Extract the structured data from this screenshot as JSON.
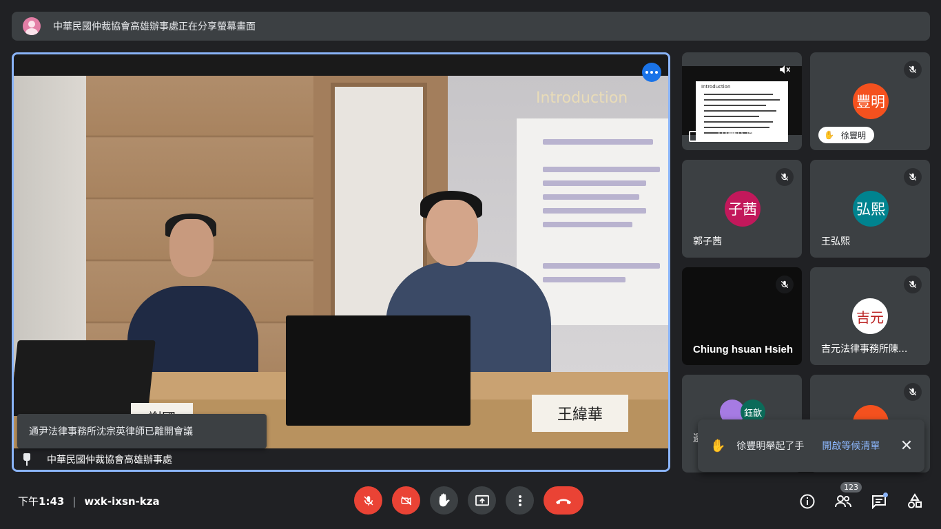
{
  "banner": {
    "presenter_text": "中華民國仲裁協會高雄辦事處正在分享螢幕畫面"
  },
  "stage": {
    "slide_title": "Introduction",
    "nameplate": "王緯華",
    "nameplate_left": "謝國",
    "toast": "通尹法律事務所沈宗英律師已離開會議",
    "pinned_name": "中華民國仲裁協會高雄辦事處"
  },
  "tiles": [
    {
      "id": "screen-share",
      "name": "中華民國仲裁...",
      "mini_title": "Introduction"
    },
    {
      "id": "feng-ming",
      "initials": "豐明",
      "name": "徐豐明",
      "color": "#f4511e",
      "hand_raised": true
    },
    {
      "id": "zi-qian",
      "initials": "子茜",
      "name": "郭子茜",
      "color": "#c2185b"
    },
    {
      "id": "hong-xi",
      "initials": "弘熙",
      "name": "王弘熙",
      "color": "#00838f"
    },
    {
      "id": "chiung",
      "name": "Chiung hsuan Hsieh"
    },
    {
      "id": "jiyuan",
      "name": "吉元法律事務所陳...",
      "seal": "吉元"
    },
    {
      "id": "others",
      "name": "還",
      "second_initials": "鈺歆"
    },
    {
      "id": "orange",
      "color": "#f4511e"
    }
  ],
  "notification": {
    "text": "徐豐明舉起了手",
    "action": "開啟等候清單",
    "close": "✕"
  },
  "footer": {
    "time_prefix": "下午",
    "time": "1:43",
    "separator": "|",
    "meeting_code": "wxk-ixsn-kza",
    "participants_count": "123"
  },
  "colors": {
    "accent": "#8ab4f8",
    "danger": "#ea4335",
    "surface": "#3c4043",
    "background": "#202124"
  }
}
